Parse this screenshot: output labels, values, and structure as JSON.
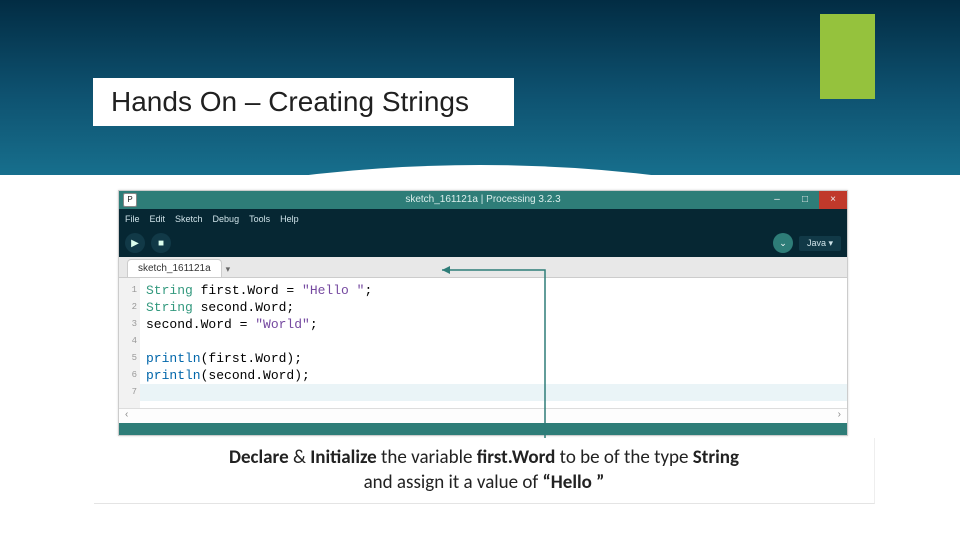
{
  "slide": {
    "title": "Hands On – Creating Strings"
  },
  "ide": {
    "app_icon_label": "P",
    "window_title": "sketch_161121a | Processing 3.2.3",
    "win_min": "–",
    "win_max": "□",
    "win_close": "×",
    "menu": [
      "File",
      "Edit",
      "Sketch",
      "Debug",
      "Tools",
      "Help"
    ],
    "run_glyph": "▶",
    "stop_glyph": "■",
    "debug_glyph": "⌄",
    "mode_label": "Java ▾",
    "tab_label": "sketch_161121a",
    "tab_drop": "▾",
    "lines": [
      "1",
      "2",
      "3",
      "4",
      "5",
      "6",
      "7"
    ],
    "scroll_left": "‹",
    "scroll_right": "›"
  },
  "code": {
    "l1_kw": "String",
    "l1_rest": " first.Word = ",
    "l1_str": "\"Hello \"",
    "l1_end": ";",
    "l2_kw": "String",
    "l2_rest": " second.Word;",
    "l3": "second.Word = ",
    "l3_str": "\"World\"",
    "l3_end": ";",
    "l5_fn": "println",
    "l5_rest": "(first.Word);",
    "l6_fn": "println",
    "l6_rest": "(second.Word);"
  },
  "caption": {
    "b1": "Declare",
    "t1": " & ",
    "b2": "Initialize",
    "t2": " the variable ",
    "b3": "first.Word",
    "t3": " to be of the type ",
    "b4": "String",
    "t4": " and assign it a value of ",
    "b5": "“Hello ”"
  }
}
